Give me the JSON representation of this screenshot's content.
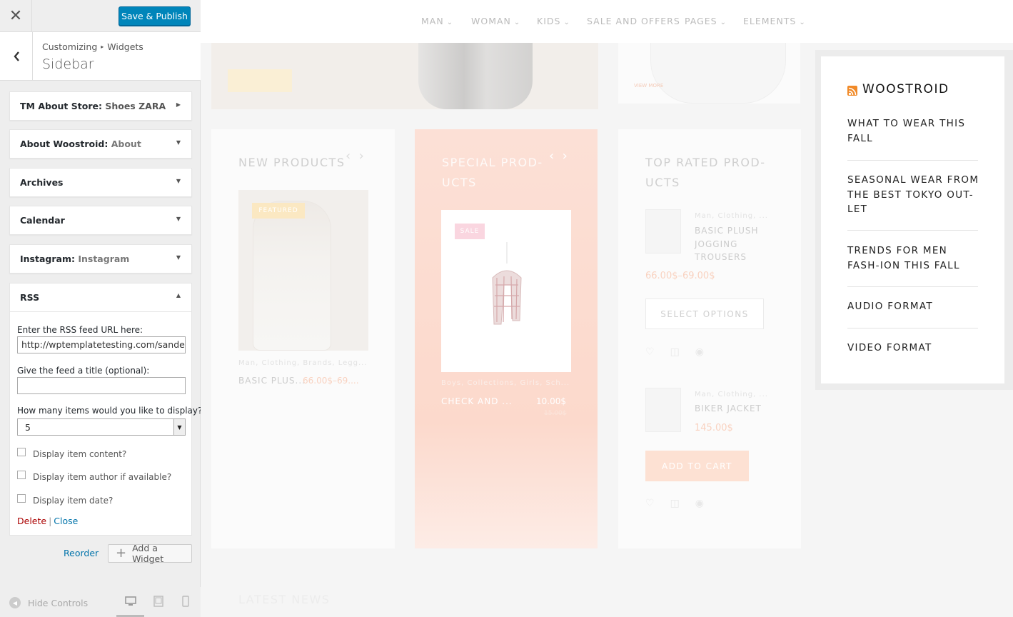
{
  "panel": {
    "close_glyph": "✕",
    "publish_label": "Save & Publish",
    "breadcrumb": {
      "root": "Customizing",
      "sep": "▸",
      "leaf": "Widgets"
    },
    "section_title": "Sidebar",
    "widgets": [
      {
        "title": "TM About Store:",
        "subtitle": "Shoes ZARA",
        "state": "collapsed-right"
      },
      {
        "title": "About Woostroid:",
        "subtitle": "About",
        "state": "collapsed"
      },
      {
        "title": "Archives",
        "subtitle": "",
        "state": "collapsed"
      },
      {
        "title": "Calendar",
        "subtitle": "",
        "state": "collapsed"
      },
      {
        "title": "Instagram:",
        "subtitle": "Instagram",
        "state": "collapsed"
      }
    ],
    "rss": {
      "title": "RSS",
      "url_label": "Enter the RSS feed URL here:",
      "url_value": "http://wptemplatetesting.com/sander/w",
      "title_label": "Give the feed a title (optional):",
      "title_value": "",
      "count_label": "How many items would you like to display?",
      "count_value": "5",
      "opt_content": "Display item content?",
      "opt_author": "Display item author if available?",
      "opt_date": "Display item date?",
      "delete_label": "Delete",
      "pipe": "|",
      "close_label": "Close"
    },
    "reorder_label": "Reorder",
    "add_widget_label": "Add a Widget",
    "hide_controls_label": "Hide Controls"
  },
  "preview": {
    "nav": [
      {
        "label": "MAN",
        "has_caret": true
      },
      {
        "label": "WOMAN",
        "has_caret": true
      },
      {
        "label": "KIDS",
        "has_caret": true
      },
      {
        "label": "SALE AND OFFERS",
        "has_caret": false
      },
      {
        "label": "PAGES",
        "has_caret": true
      },
      {
        "label": "ELEMENTS",
        "has_caret": true
      }
    ],
    "banner_btn": "VIEW MORE",
    "banner_right_btn": "VIEW MORE",
    "col1": {
      "title": "NEW PRODUCTS",
      "badge": "FEATURED",
      "cats": "Man, Clothing, Brands, Legg...",
      "name": "BASIC PLUS...",
      "price": "66.00$–69...."
    },
    "col2": {
      "title": "SPECIAL PROD-UCTS",
      "badge": "SALE",
      "cats": "Boys, Collections, Girls, Sch...",
      "name": "CHECK AND ...",
      "price": "10.00$",
      "old_price": "15.00$"
    },
    "col3": {
      "title": "TOP RATED PROD-UCTS",
      "item1": {
        "cats": "Man, Clothing, ...",
        "name": "BASIC PLUSH JOGGING TROUSERS",
        "price": "66.00$–69.00$"
      },
      "select_options": "SELECT OPTIONS",
      "item2": {
        "cats": "Man, Clothing, ...",
        "name": "BIKER JACKET",
        "price": "145.00$"
      },
      "add_to_cart": "ADD TO CART"
    },
    "latest_news": "LATEST NEWS",
    "sidebar_rss": {
      "title": "WOOSTROID",
      "items": [
        "WHAT TO WEAR THIS FALL",
        "SEASONAL WEAR FROM THE BEST TOKYO OUT-LET",
        "TRENDS FOR MEN FASH-ION THIS FALL",
        "AUDIO FORMAT",
        "VIDEO FORMAT"
      ]
    }
  },
  "colors": {
    "primary_button": "#0085ba",
    "link": "#0073aa",
    "delete": "#aa0000",
    "rss_orange": "#f18a28",
    "sale_panel": "#fcd9cc"
  }
}
